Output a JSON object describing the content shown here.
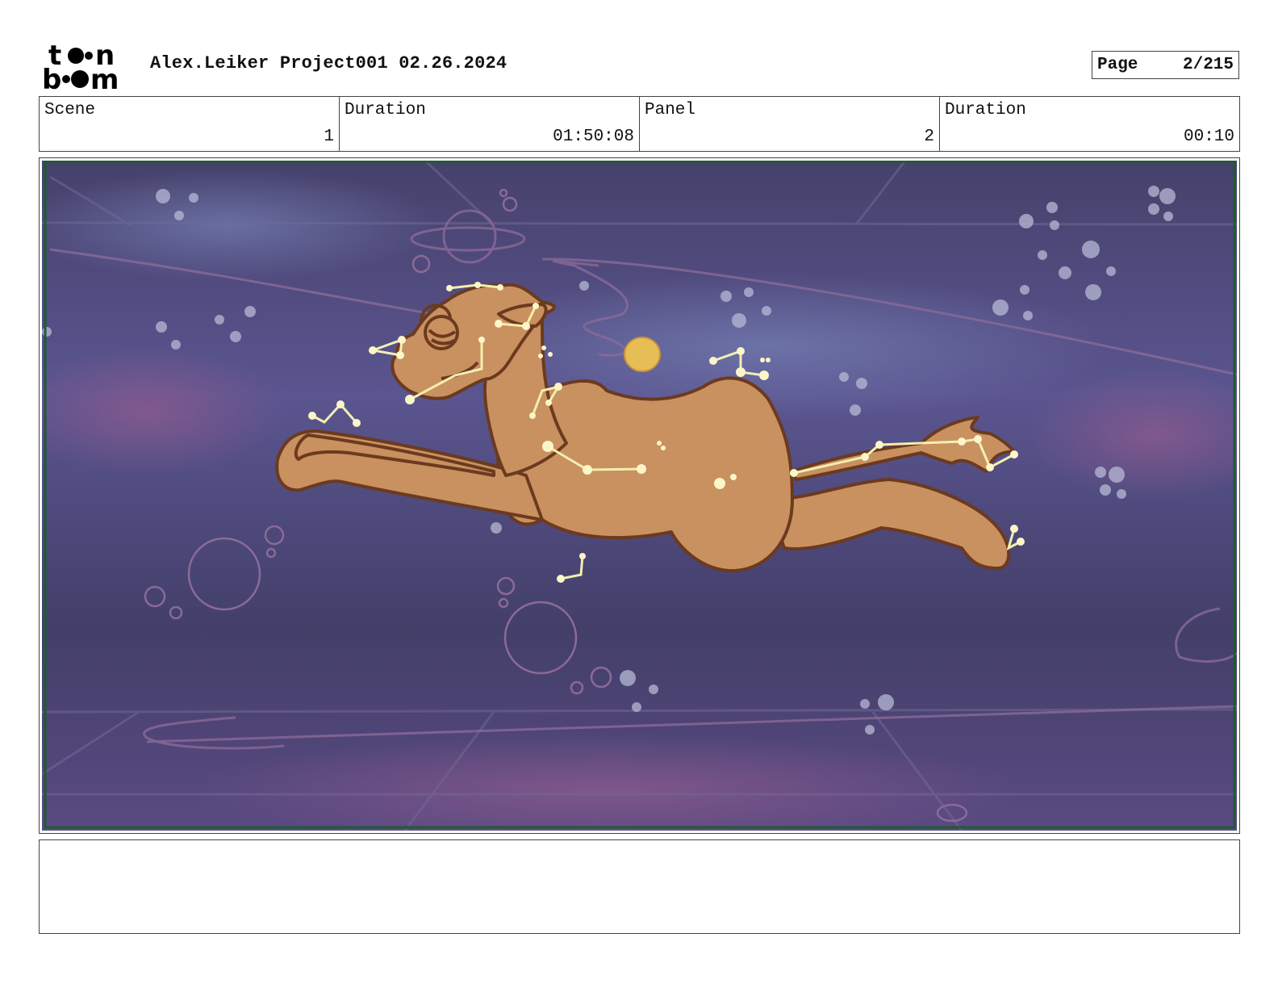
{
  "header": {
    "logo_text": [
      "t",
      "n",
      "b",
      "m"
    ],
    "project_title": "Alex.Leiker Project001 02.26.2024",
    "page_label": "Page",
    "page_value": "2/215"
  },
  "info": [
    {
      "label": "Scene",
      "value": "1"
    },
    {
      "label": "Duration",
      "value": "01:50:08"
    },
    {
      "label": "Panel",
      "value": "2"
    },
    {
      "label": "Duration",
      "value": "00:10"
    }
  ],
  "panel": {
    "subject": "camel-constellation",
    "colors": {
      "sky": "#4a4470",
      "camel": "#c9915f",
      "outline": "#6b3a1f",
      "stars": "#f2efb0",
      "moon": "#e7be55",
      "frame": "#1f5b34"
    }
  },
  "notes": {
    "text": ""
  }
}
